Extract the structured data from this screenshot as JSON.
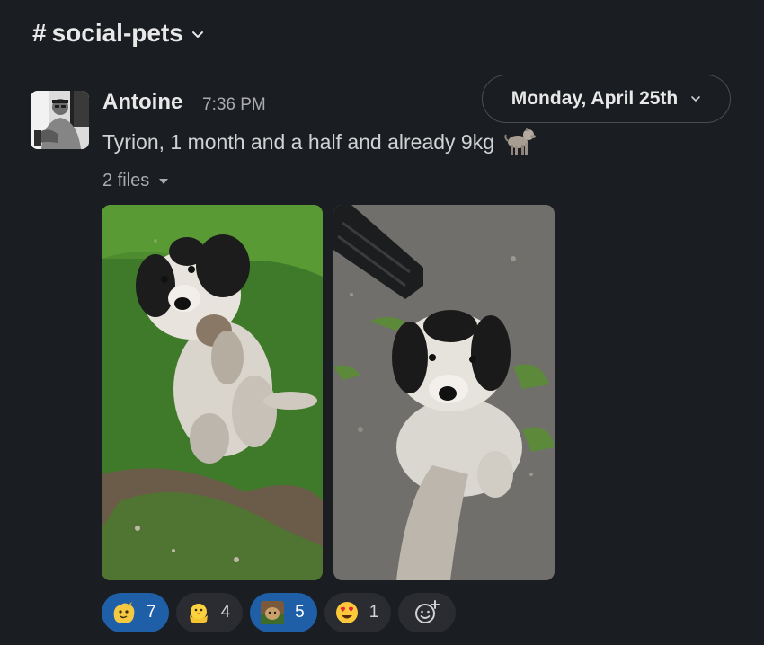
{
  "channel": {
    "hash": "#",
    "name": "social-pets"
  },
  "date_divider": {
    "label": "Monday, April 25th"
  },
  "message": {
    "author": "Antoine",
    "time": "7:36 PM",
    "text": "Tyrion, 1 month and a half and already 9kg",
    "inline_emoji": "dog-icon",
    "files_label": "2 files",
    "attachments": [
      {
        "alt": "puppy-sitting-on-grass-photo"
      },
      {
        "alt": "puppy-on-gravel-photo"
      }
    ],
    "reactions": [
      {
        "emoji": "custom-yellow-blob-emoji",
        "count": "7",
        "active": true
      },
      {
        "emoji": "hatching-chick-emoji",
        "count": "4",
        "active": false
      },
      {
        "emoji": "custom-dog-photo-emoji",
        "count": "5",
        "active": true
      },
      {
        "emoji": "heart-eyes-emoji",
        "count": "1",
        "active": false
      }
    ]
  },
  "colors": {
    "background": "#1a1d21",
    "active_reaction": "#1f5fa8",
    "reaction_pill": "#2a2c31",
    "text_primary": "#d1d2d3",
    "text_muted": "#ababad"
  }
}
